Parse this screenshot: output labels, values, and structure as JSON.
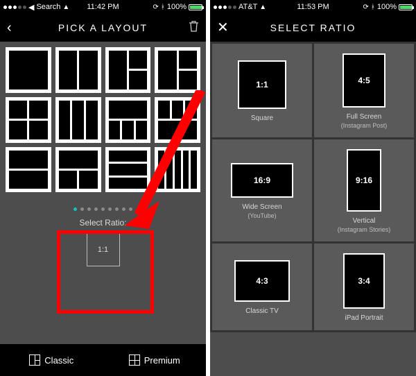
{
  "left": {
    "statusbar": {
      "carrier_back_label": "Search",
      "time": "11:42 PM",
      "battery_pct": "100%",
      "signal_dots": 3
    },
    "header": {
      "title": "PICK A LAYOUT"
    },
    "ratio_panel": {
      "label": "Select Ratio:",
      "value": "1:1",
      "page_count": 9,
      "active_page": 0
    },
    "tabs": {
      "classic": "Classic",
      "premium": "Premium"
    }
  },
  "right": {
    "statusbar": {
      "carrier": "AT&T",
      "time": "11:53 PM",
      "battery_pct": "100%",
      "signal_dots": 3
    },
    "header": {
      "title": "SELECT RATIO"
    },
    "ratios": [
      {
        "badge": "1:1",
        "name": "Square",
        "sub": "",
        "cls": "ar-1-1"
      },
      {
        "badge": "4:5",
        "name": "Full Screen",
        "sub": "(Instagram Post)",
        "cls": "ar-4-5"
      },
      {
        "badge": "16:9",
        "name": "Wide Screen",
        "sub": "(YouTube)",
        "cls": "ar-16-9"
      },
      {
        "badge": "9:16",
        "name": "Vertical",
        "sub": "(Instagram Stories)",
        "cls": "ar-9-16"
      },
      {
        "badge": "4:3",
        "name": "Classic TV",
        "sub": "",
        "cls": "ar-4-3"
      },
      {
        "badge": "3:4",
        "name": "iPad Portrait",
        "sub": "",
        "cls": "ar-3-4"
      }
    ]
  }
}
